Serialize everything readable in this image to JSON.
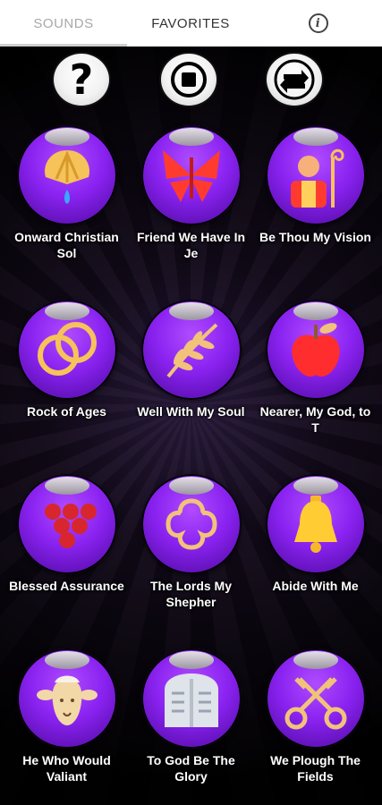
{
  "tabs": {
    "sounds": "SOUNDS",
    "favorites": "FAVORITES",
    "info": "i"
  },
  "controls": {
    "help": "?",
    "stop_icon": "stop-icon",
    "repeat_icon": "repeat-icon"
  },
  "colors": {
    "orb": "#8a22f0",
    "tab_active_bg": "#ffffff",
    "label": "#ffffff"
  },
  "sounds": [
    {
      "label": "Onward Christian Sol",
      "icon": "shell-water-icon"
    },
    {
      "label": "Friend We Have In Je",
      "icon": "butterfly-icon"
    },
    {
      "label": "Be Thou My Vision",
      "icon": "bishop-icon"
    },
    {
      "label": "Rock of Ages",
      "icon": "rings-icon"
    },
    {
      "label": "Well With My Soul",
      "icon": "palm-branch-icon"
    },
    {
      "label": "Nearer, My God, to T",
      "icon": "apple-icon"
    },
    {
      "label": "Blessed Assurance",
      "icon": "grapes-icon"
    },
    {
      "label": "The Lords My Shepher",
      "icon": "quatrefoil-icon"
    },
    {
      "label": "Abide With Me",
      "icon": "bell-icon"
    },
    {
      "label": "He Who Would Valiant",
      "icon": "lamb-icon"
    },
    {
      "label": "To God Be The Glory",
      "icon": "tablets-icon"
    },
    {
      "label": "We Plough The Fields",
      "icon": "keys-icon"
    }
  ]
}
